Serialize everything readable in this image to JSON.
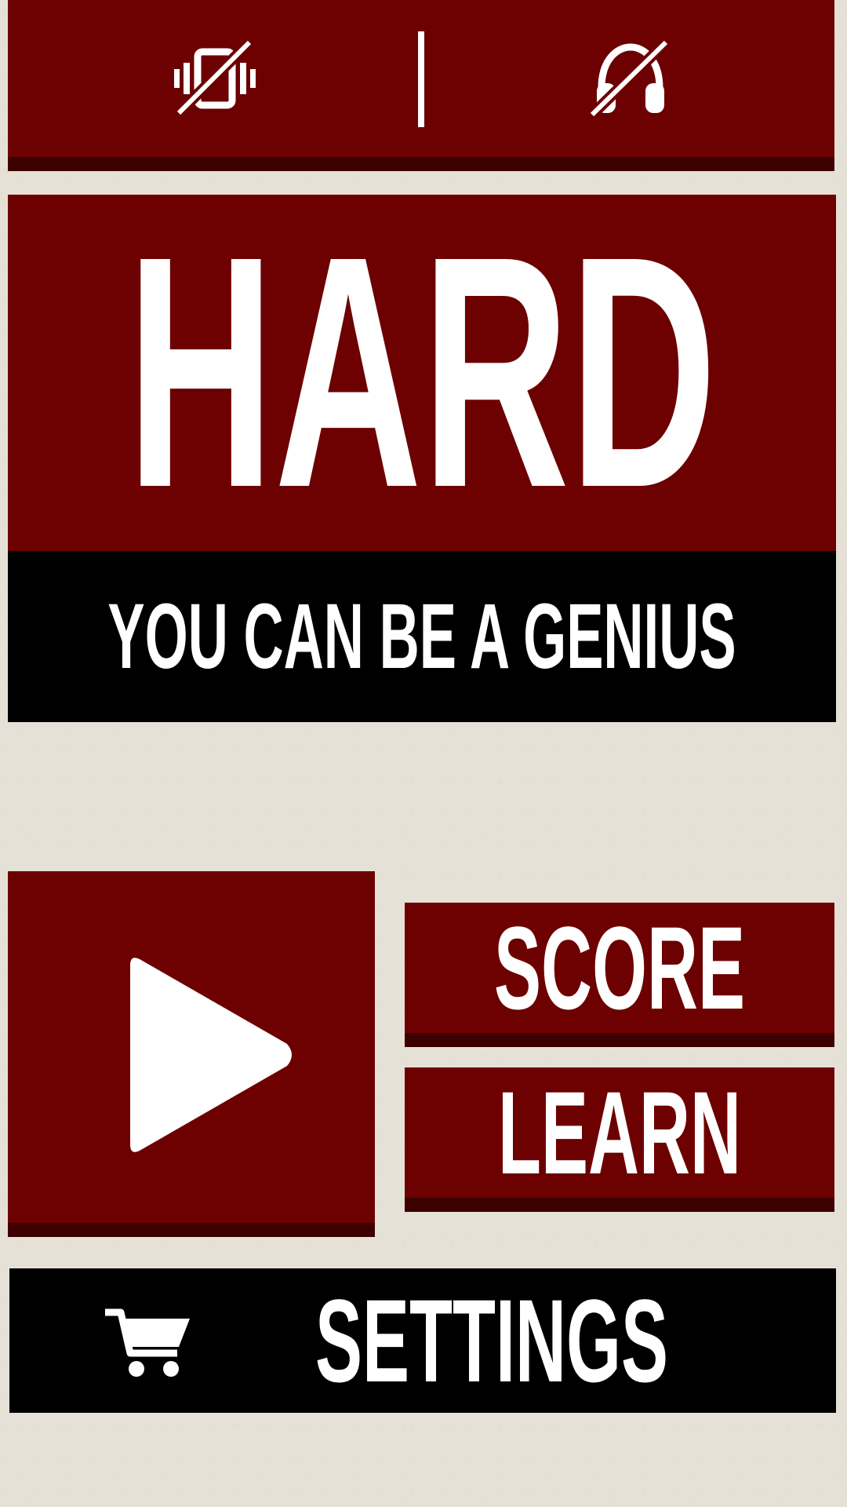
{
  "top_bar": {
    "vibration_icon": "vibration-off-icon",
    "sound_icon": "headphones-off-icon"
  },
  "title": {
    "main": "HARD",
    "tagline": "YOU CAN BE A GENIUS"
  },
  "menu": {
    "play_icon": "play-icon",
    "score_label": "SCORE",
    "learn_label": "LEARN",
    "settings_label": "SETTINGS",
    "cart_icon": "shopping-cart-icon"
  },
  "colors": {
    "primary_red": "#6d0000",
    "shadow_red": "#3d0000",
    "black": "#000000",
    "background": "#e6e1d6",
    "text": "#ffffff"
  }
}
